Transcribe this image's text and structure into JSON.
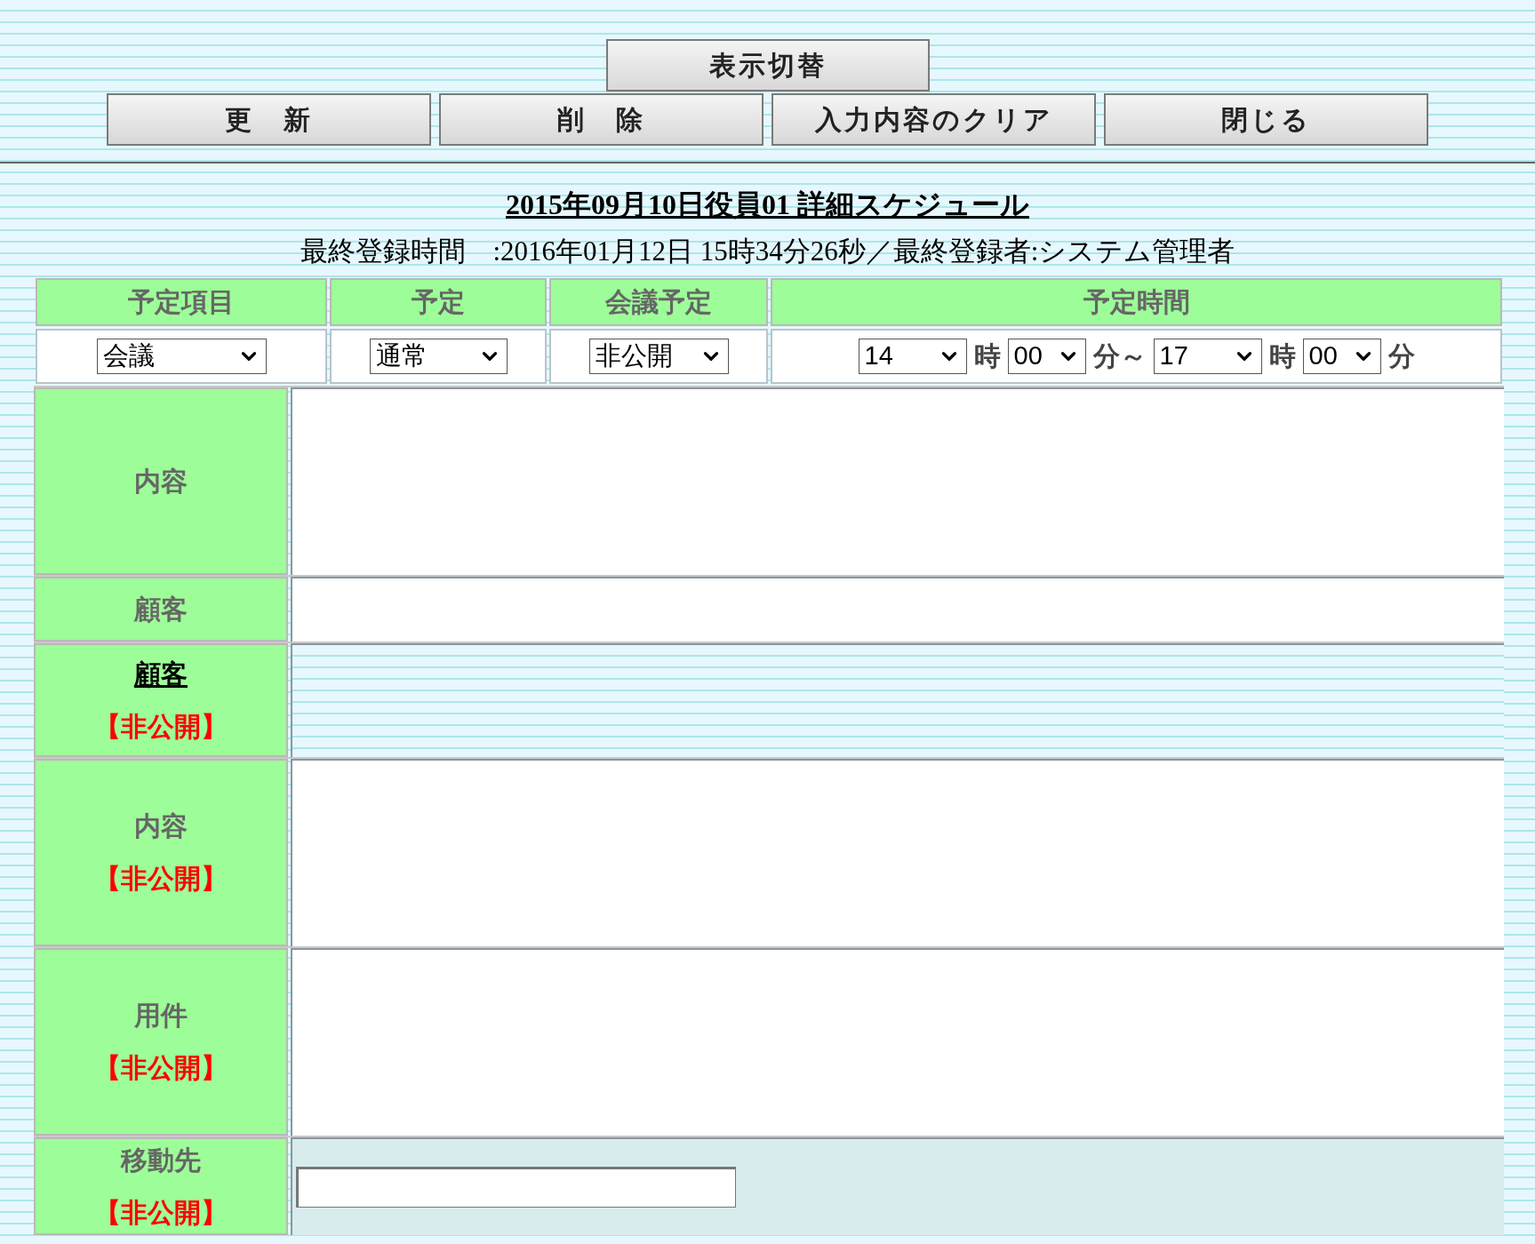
{
  "toggle_button": {
    "label": "表示切替"
  },
  "action_buttons": [
    {
      "label": "更　新"
    },
    {
      "label": "削　除"
    },
    {
      "label": "入力内容のクリア"
    },
    {
      "label": "閉じる"
    }
  ],
  "title": "2015年09月10日役員01 詳細スケジュール",
  "last_updated": "最終登録時間　:2016年01月12日 15時34分26秒／最終登録者:システム管理者",
  "header_columns": [
    {
      "label": "予定項目"
    },
    {
      "label": "予定"
    },
    {
      "label": "会議予定"
    },
    {
      "label": "予定時間"
    }
  ],
  "selects": {
    "item": "会議",
    "schedule": "通常",
    "meeting": "非公開",
    "time": [
      {
        "kind": "select",
        "value": "14"
      },
      {
        "kind": "unit",
        "text": "時"
      },
      {
        "kind": "select",
        "value": "00"
      },
      {
        "kind": "unit",
        "text": "分～"
      },
      {
        "kind": "select",
        "value": "17"
      },
      {
        "kind": "unit",
        "text": "時"
      },
      {
        "kind": "select",
        "value": "00"
      },
      {
        "kind": "unit",
        "text": "分"
      }
    ]
  },
  "fields": [
    {
      "label": "内容",
      "kind": "textarea"
    },
    {
      "label": "顧客",
      "kind": "text"
    },
    {
      "label": "顧客",
      "private": "【非公開】",
      "kind": "link"
    },
    {
      "label": "内容",
      "private": "【非公開】",
      "kind": "textarea"
    },
    {
      "label": "用件",
      "private": "【非公開】",
      "kind": "textarea"
    },
    {
      "label": "移動先",
      "private": "【非公開】",
      "kind": "input"
    }
  ]
}
